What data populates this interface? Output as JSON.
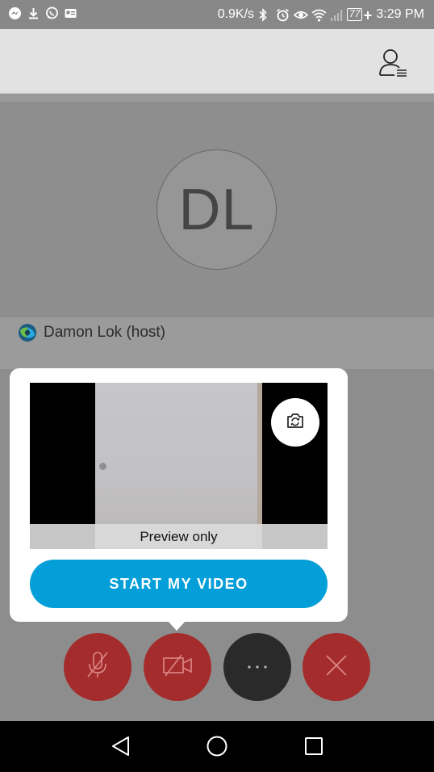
{
  "status_bar": {
    "speed": "0.9K/s",
    "battery": "77",
    "time": "3:29 PM",
    "icons": [
      "messenger-icon",
      "download-icon",
      "whatsapp-icon",
      "id-card-icon",
      "bluetooth-icon",
      "alarm-icon",
      "eye-icon",
      "wifi-icon",
      "signal-icon",
      "battery-icon"
    ]
  },
  "header": {
    "participants_icon": "participants-list-icon"
  },
  "meeting": {
    "avatar_initials": "DL",
    "host_name": "Damon Lok (host)"
  },
  "video_popup": {
    "preview_label": "Preview only",
    "start_button_label": "START MY VIDEO",
    "switch_camera_icon": "switch-camera-icon"
  },
  "controls": [
    {
      "name": "mute-button",
      "icon": "microphone-off-icon"
    },
    {
      "name": "video-button",
      "icon": "camera-off-icon"
    },
    {
      "name": "more-button",
      "icon": "more-dots-icon"
    },
    {
      "name": "leave-button",
      "icon": "close-icon"
    }
  ],
  "nav_bar": [
    "back-icon",
    "home-icon",
    "recents-icon"
  ],
  "colors": {
    "accent_blue": "#049fd9",
    "control_red": "#a42c2c",
    "control_dark": "#2a2a2a",
    "header_bg": "#e2e2e2"
  }
}
